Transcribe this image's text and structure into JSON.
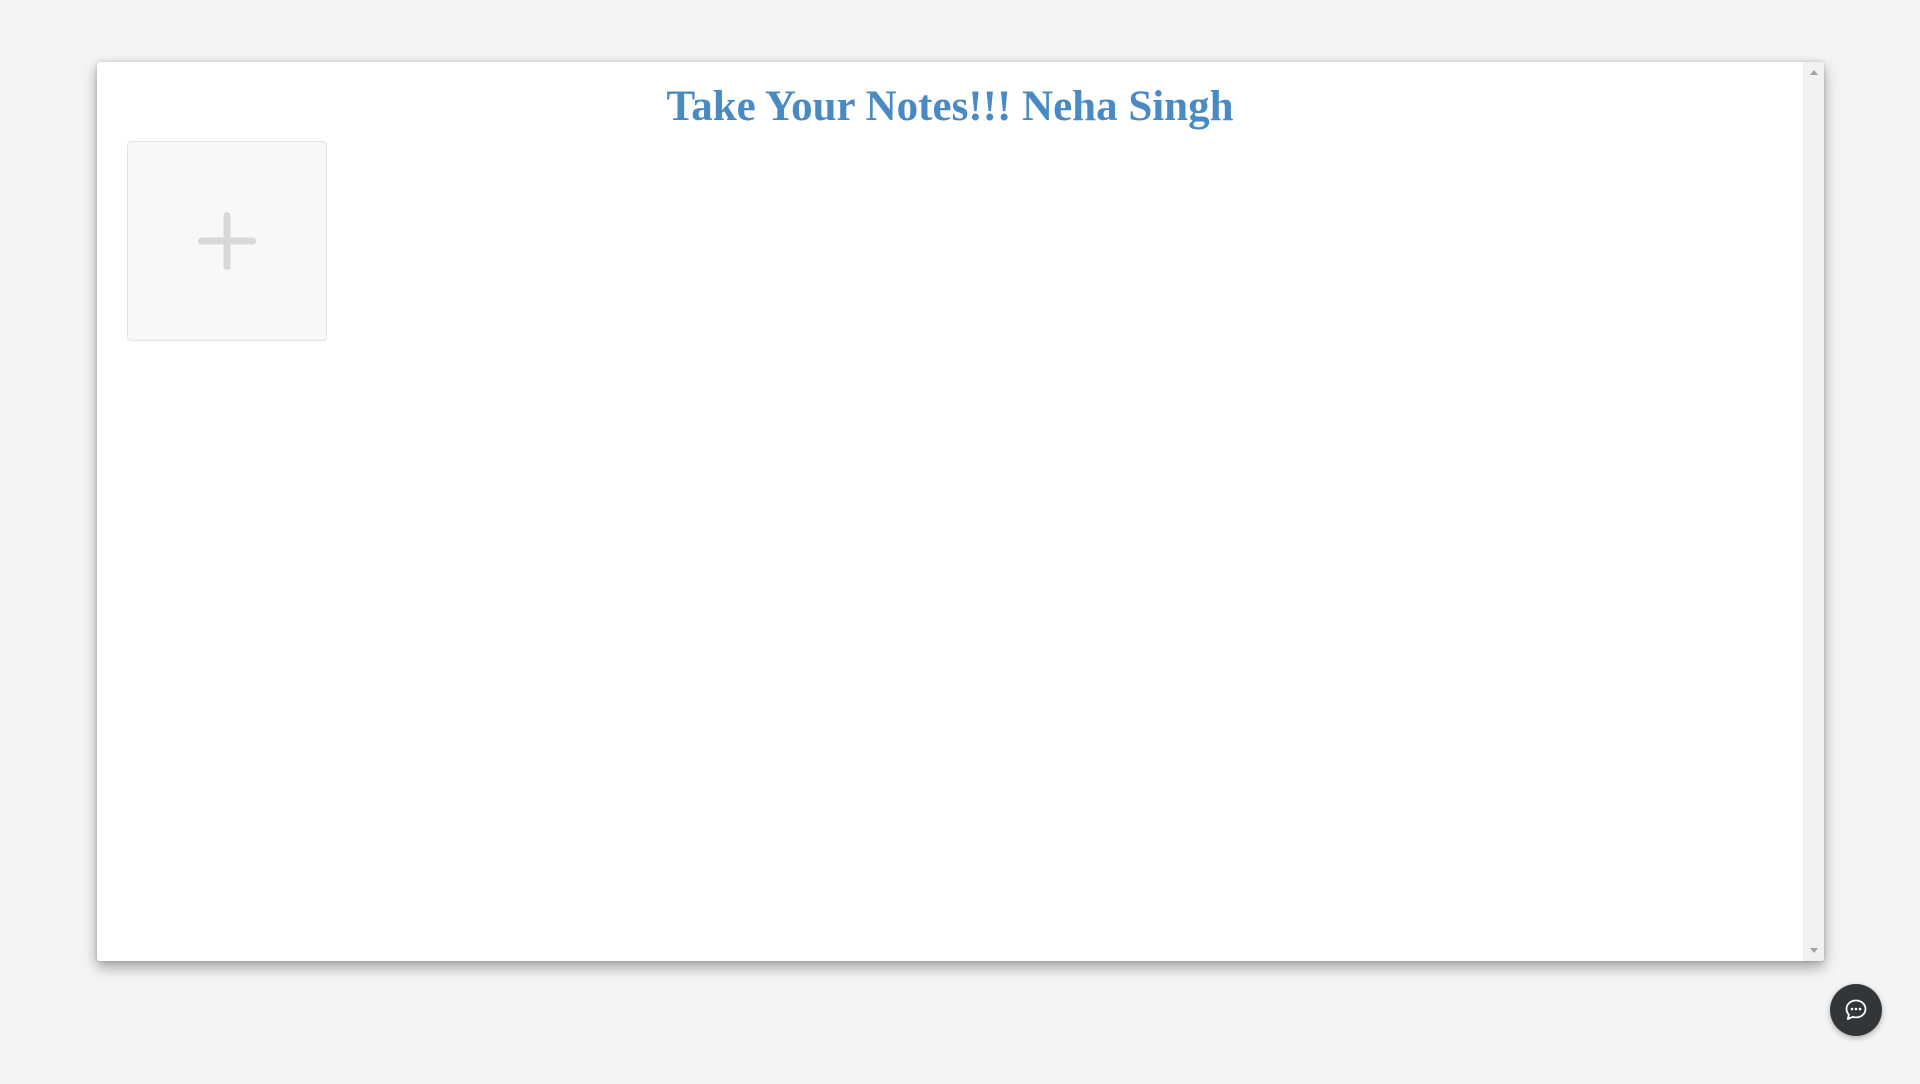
{
  "header": {
    "title": "Take Your Notes!!! Neha Singh"
  },
  "notes": {
    "add_icon": "plus-icon"
  },
  "chat": {
    "icon": "chat-bubble-icon"
  },
  "colors": {
    "title": "#4a8ac4",
    "background": "#f4f4f4",
    "card": "#f8f8f8",
    "chat_button": "#333638"
  }
}
